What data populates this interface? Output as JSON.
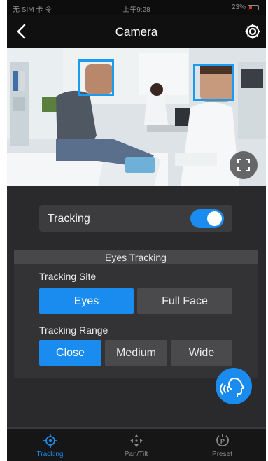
{
  "status_bar": {
    "carrier": "无 SIM 卡 令",
    "time": "上午9:28",
    "battery": "23%"
  },
  "header": {
    "title": "Camera",
    "back_icon": "chevron-left-icon",
    "settings_icon": "gear-icon"
  },
  "camera": {
    "faces_detected": 2,
    "box_color": "#1a9bf0",
    "fullscreen_icon": "fullscreen-icon"
  },
  "tracking": {
    "label": "Tracking",
    "enabled": true
  },
  "eyes_tracking": {
    "title": "Eyes Tracking",
    "site": {
      "label": "Tracking Site",
      "options": [
        "Eyes",
        "Full Face"
      ],
      "selected": "Eyes"
    },
    "range": {
      "label": "Tracking Range",
      "options": [
        "Close",
        "Medium",
        "Wide"
      ],
      "selected": "Close"
    }
  },
  "voice_button": {
    "icon": "voice-command-icon"
  },
  "bottom_nav": {
    "items": [
      {
        "label": "Tracking",
        "icon": "target-icon",
        "active": true
      },
      {
        "label": "Pan/Tilt",
        "icon": "move-arrows-icon",
        "active": false
      },
      {
        "label": "Preset",
        "icon": "preset-p-icon",
        "active": false
      }
    ]
  },
  "colors": {
    "accent": "#1a8cf0",
    "panel": "#2a2a2c",
    "button_inactive": "#4a4a4c"
  }
}
